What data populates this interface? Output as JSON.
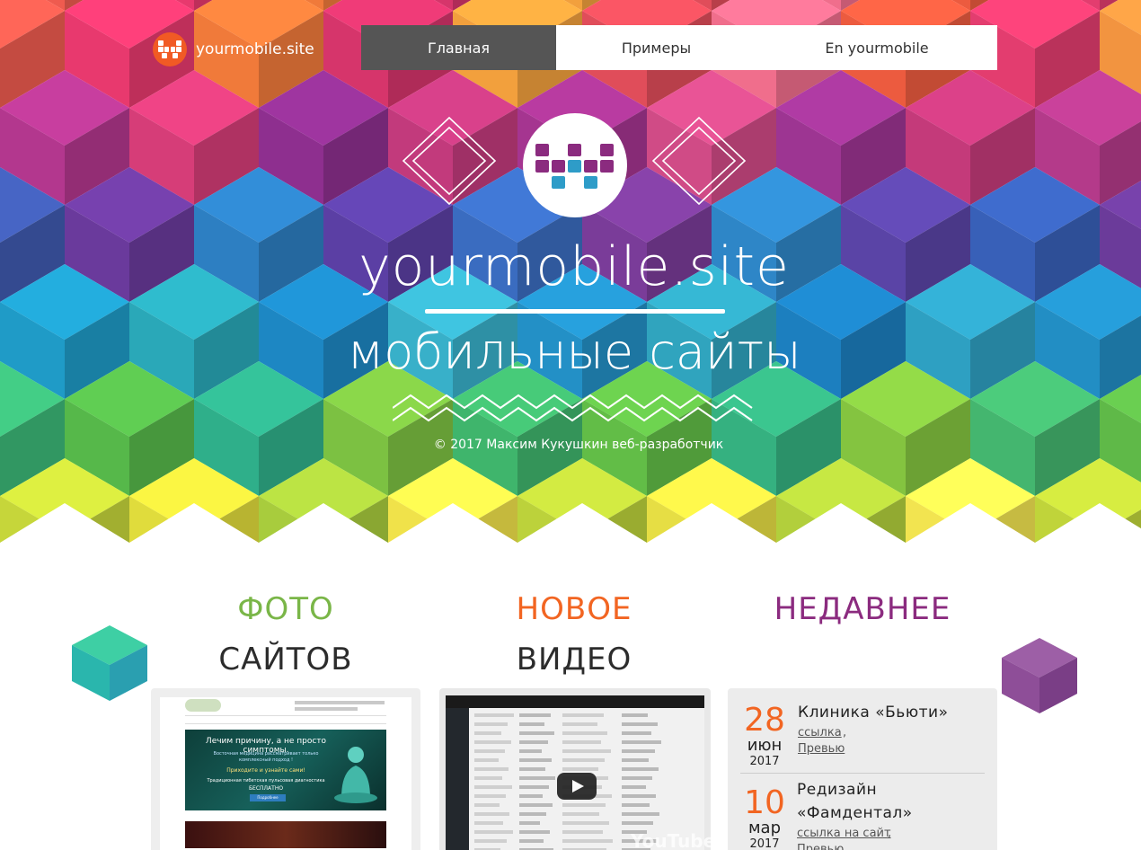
{
  "brand": {
    "name": "yourmobile.site"
  },
  "nav": {
    "tabs": [
      "Главная",
      "Примеры",
      "En yourmobile"
    ]
  },
  "hero": {
    "title": "yourmobile.site",
    "subtitle": "мобильные сайты",
    "copyright": "© 2017 Максим Кукушкин веб-разработчик"
  },
  "columns": [
    {
      "line1": "ФОТО",
      "line2": "САЙТОВ",
      "color": "#7ab648"
    },
    {
      "line1": "НОВОЕ",
      "line2": "ВИДЕО",
      "color": "#f26522"
    },
    {
      "line1": "НЕДАВНЕЕ",
      "line2": "",
      "color": "#8b2b7f"
    }
  ],
  "photo_card": {
    "banner_line1": "Лечим причину,  а не просто симптомы.",
    "banner_line2": "Восточная медицина рассматривает только комплексный подход !",
    "banner_line3": "Приходите и узнайте сами!",
    "banner_line4": "Традиционная тибетская пульсовая диагностика",
    "banner_line5": "БЕСПЛАТНО",
    "banner_button": "Подробнее"
  },
  "video_card": {
    "watermark": "YouTube"
  },
  "news": [
    {
      "day": "28",
      "month": "июн",
      "year": "2017",
      "title": "Клиника «Бьюти»",
      "link1": "ссылка",
      "link2": "Превью"
    },
    {
      "day": "10",
      "month": "мар",
      "year": "2017",
      "title_line1": "Редизайн",
      "title_line2": "«Фамдентал»",
      "link1": "ссылка на сайт",
      "link2": "Превью"
    }
  ],
  "colors": {
    "accent_orange": "#f26522",
    "accent_green": "#7ab648",
    "accent_purple": "#8b2b7f",
    "nav_active": "#555555"
  }
}
